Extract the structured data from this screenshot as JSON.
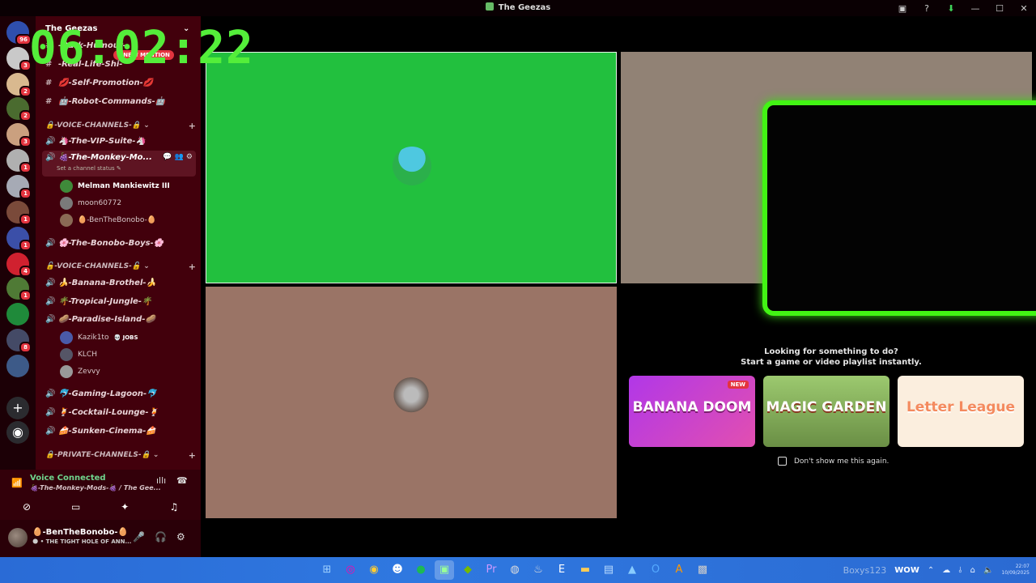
{
  "window": {
    "title": "The Geezas"
  },
  "timer": "06:02:22",
  "servers": [
    {
      "badge": "96",
      "color": "#2f4fae"
    },
    {
      "badge": "3",
      "color": "#c9c9c9"
    },
    {
      "badge": "2",
      "color": "#d9b98f"
    },
    {
      "badge": "2",
      "color": "#4a6b2f"
    },
    {
      "badge": "3",
      "color": "#caa07f"
    },
    {
      "badge": "1",
      "color": "#b0b0b0"
    },
    {
      "badge": "1",
      "color": "#a6aab5"
    },
    {
      "badge": "1",
      "color": "#7a4a3a"
    },
    {
      "badge": "1",
      "color": "#3b4fa8"
    },
    {
      "badge": "4",
      "color": "#d0212f"
    },
    {
      "badge": "1",
      "color": "#4f7a35"
    },
    {
      "badge": "",
      "color": "#1f8a3a"
    },
    {
      "badge": "8",
      "color": "#444a66"
    },
    {
      "badge": "",
      "color": "#3d5a88"
    }
  ],
  "guild": {
    "name": "The Geezas",
    "new_pill": "1 NEW MENTION"
  },
  "channels": {
    "top": [
      {
        "name": "-Dark-Humour-"
      },
      {
        "name": "-Real-Life-Shi-"
      },
      {
        "name": "💋-Self-Promotion-💋"
      },
      {
        "name": "🤖-Robot-Commands-🤖"
      }
    ],
    "cat1": "🔒-VOICE-CHANNELS-🔒",
    "vip": "🦄-The-VIP-Suite-🦄",
    "active": {
      "name": "🍇-The-Monkey-Mo...",
      "status": "Set a channel status ✎"
    },
    "active_users": [
      {
        "name": "Melman Mankiewitz III",
        "bold": true,
        "color": "#3f8a3a"
      },
      {
        "name": "moon60772",
        "bold": false,
        "color": "#7a7a7a"
      },
      {
        "name": "🥚-BenTheBonobo-🥚",
        "bold": false,
        "color": "#8a6a55"
      }
    ],
    "bonobo": "🌸-The-Bonobo-Boys-🌸",
    "cat2": "🔓-VOICE-CHANNELS-🔓",
    "voice2": [
      {
        "name": "🍌-Banana-Brothel-🍌"
      },
      {
        "name": "🌴-Tropical-Jungle-🌴"
      },
      {
        "name": "🥔-Paradise-Island-🥔"
      }
    ],
    "island_users": [
      {
        "name": "Kazik1to",
        "tag": "💀 JOBS",
        "color": "#4a5aa8"
      },
      {
        "name": "KLCH",
        "tag": "",
        "color": "#556"
      },
      {
        "name": "Zevvy",
        "tag": "",
        "color": "#999"
      }
    ],
    "voice3": [
      {
        "name": "🐬-Gaming-Lagoon-🐬"
      },
      {
        "name": "🍹-Cocktail-Lounge-🍹"
      },
      {
        "name": "🍰-Sunken-Cinema-🍰"
      }
    ],
    "cat3": "🔒-PRIVATE-CHANNELS-🔒"
  },
  "voice": {
    "title": "Voice Connected",
    "sub": "🍇-The-Monkey-Mods-🍇 / The Gee..."
  },
  "user": {
    "name": "🥚-BenTheBonobo-🥚",
    "status": "🌑 • THE TIGHT HOLE OF ANN..."
  },
  "activity": {
    "line1": "Looking for something to do?",
    "line2": "Start a game or video playlist instantly.",
    "cards": [
      {
        "label": "BANANA DOOM",
        "new": "NEW"
      },
      {
        "label": "MAGIC GARDEN",
        "new": ""
      },
      {
        "label": "Letter League",
        "new": ""
      }
    ],
    "dont_show": "Don't show me this again."
  },
  "taskbar": {
    "watermark": "Boxys123",
    "wow": "WOW",
    "time": "22:07",
    "date": "10/09/2025"
  }
}
